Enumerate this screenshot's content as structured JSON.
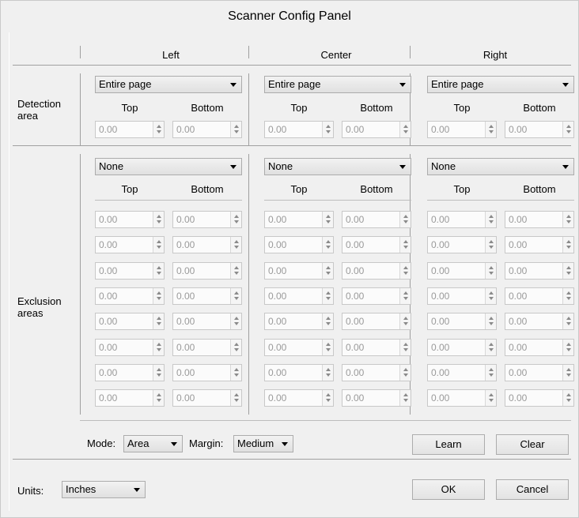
{
  "window": {
    "title": "Scanner Config Panel"
  },
  "columns": [
    {
      "id": "left",
      "label": "Left",
      "detection_select": "Entire page",
      "exclusion_select": "None"
    },
    {
      "id": "center",
      "label": "Center",
      "detection_select": "Entire page",
      "exclusion_select": "None"
    },
    {
      "id": "right",
      "label": "Right",
      "detection_select": "Entire page",
      "exclusion_select": "None"
    }
  ],
  "detection": {
    "label_line1": "Detection",
    "label_line2": "area",
    "top_label": "Top",
    "bottom_label": "Bottom",
    "values": [
      [
        "0.00",
        "0.00"
      ],
      [
        "0.00",
        "0.00"
      ],
      [
        "0.00",
        "0.00"
      ]
    ]
  },
  "exclusion": {
    "label_line1": "Exclusion",
    "label_line2": "areas",
    "top_label": "Top",
    "bottom_label": "Bottom",
    "rows": 8,
    "value": "0.00"
  },
  "mode": {
    "label": "Mode:",
    "value": "Area"
  },
  "margin": {
    "label": "Margin:",
    "value": "Medium"
  },
  "buttons": {
    "learn": "Learn",
    "clear": "Clear",
    "ok": "OK",
    "cancel": "Cancel"
  },
  "units": {
    "label": "Units:",
    "value": "Inches"
  },
  "icons": {
    "dropdown": "chevron-down-icon",
    "spinner": "spinner-arrows-icon"
  }
}
